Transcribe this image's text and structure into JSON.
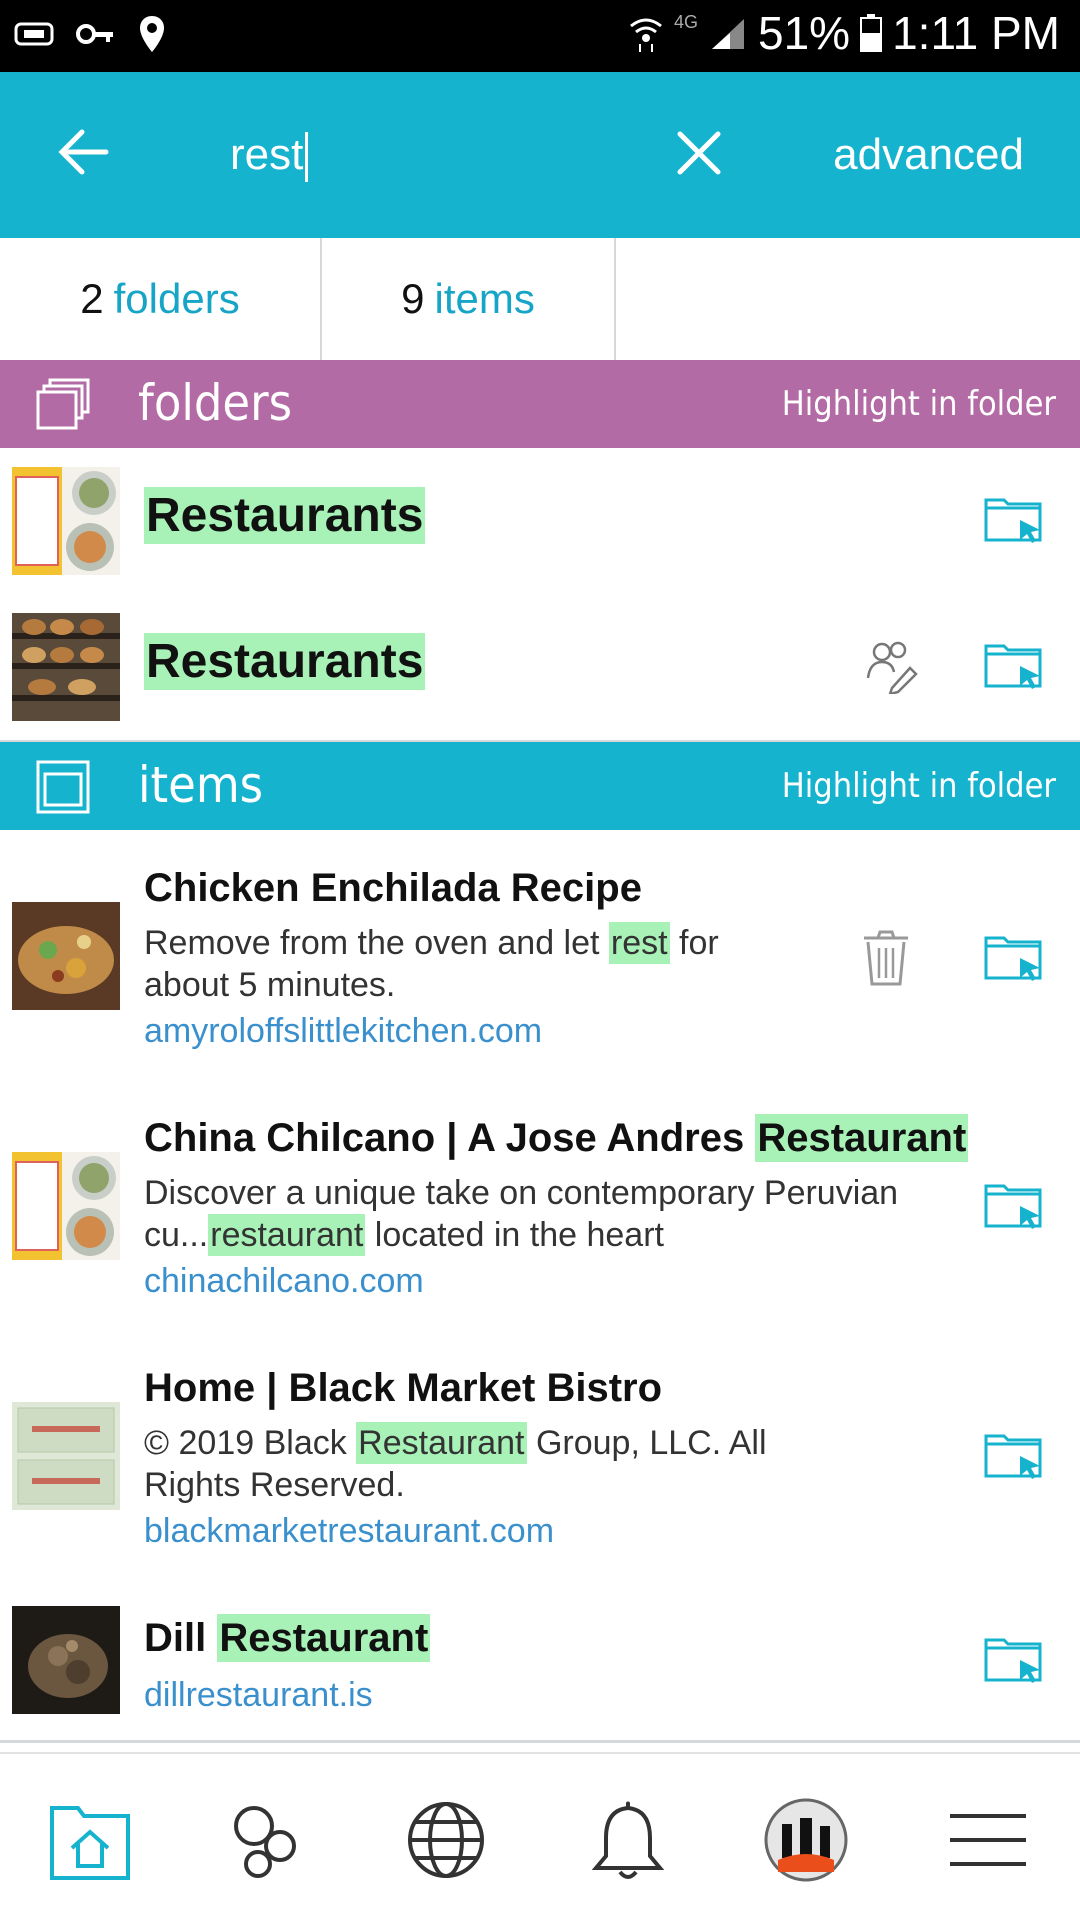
{
  "status_bar": {
    "battery": "51%",
    "time": "1:11 PM",
    "network": "4G"
  },
  "search": {
    "query": "rest",
    "advanced_label": "advanced"
  },
  "counts": {
    "folders_count": "2",
    "folders_label": "folders",
    "items_count": "9",
    "items_label": "items"
  },
  "folders_section": {
    "title": "folders",
    "highlight_label": "Highlight in folder",
    "color": "#b26ba4",
    "rows": [
      {
        "title": "Restaurants",
        "thumb": "food-bowls-thumbnail"
      },
      {
        "title": "Restaurants",
        "thumb": "bakery-shelf-thumbnail"
      }
    ]
  },
  "items_section": {
    "title": "items",
    "highlight_label": "Highlight in folder",
    "color": "#16b3cf",
    "rows": [
      {
        "title_pre": "Chicken Enchilada Recipe",
        "title_mark": "",
        "snippet_pre": "Remove from the oven and let ",
        "snippet_mark": "rest",
        "snippet_post": " for about 5 minutes.",
        "domain": "amyroloffslittlekitchen.com"
      },
      {
        "title_pre": "China Chilcano | A Jose Andres ",
        "title_mark": "Restaurant",
        "snippet_pre": "Discover a unique take on contemporary Peruvian cu...",
        "snippet_mark": "restaurant",
        "snippet_post": " located in the heart",
        "domain": "chinachilcano.com"
      },
      {
        "title_pre": "Home | Black Market Bistro",
        "title_mark": "",
        "snippet_pre": "© 2019 Black ",
        "snippet_mark": "Restaurant",
        "snippet_post": " Group, LLC. All Rights Reserved.",
        "domain": "blackmarketrestaurant.com"
      },
      {
        "title_pre": "Dill ",
        "title_mark": "Restaurant",
        "domain": "dillrestaurant.is"
      }
    ]
  },
  "colors": {
    "accent": "#16b3cf",
    "folder_header": "#b26ba4",
    "highlight": "#a8f2b8",
    "link": "#3a8fcd"
  },
  "bottom_nav": [
    "home-folder-icon",
    "circles-icon",
    "globe-icon",
    "bell-icon",
    "avatar",
    "menu-icon"
  ]
}
